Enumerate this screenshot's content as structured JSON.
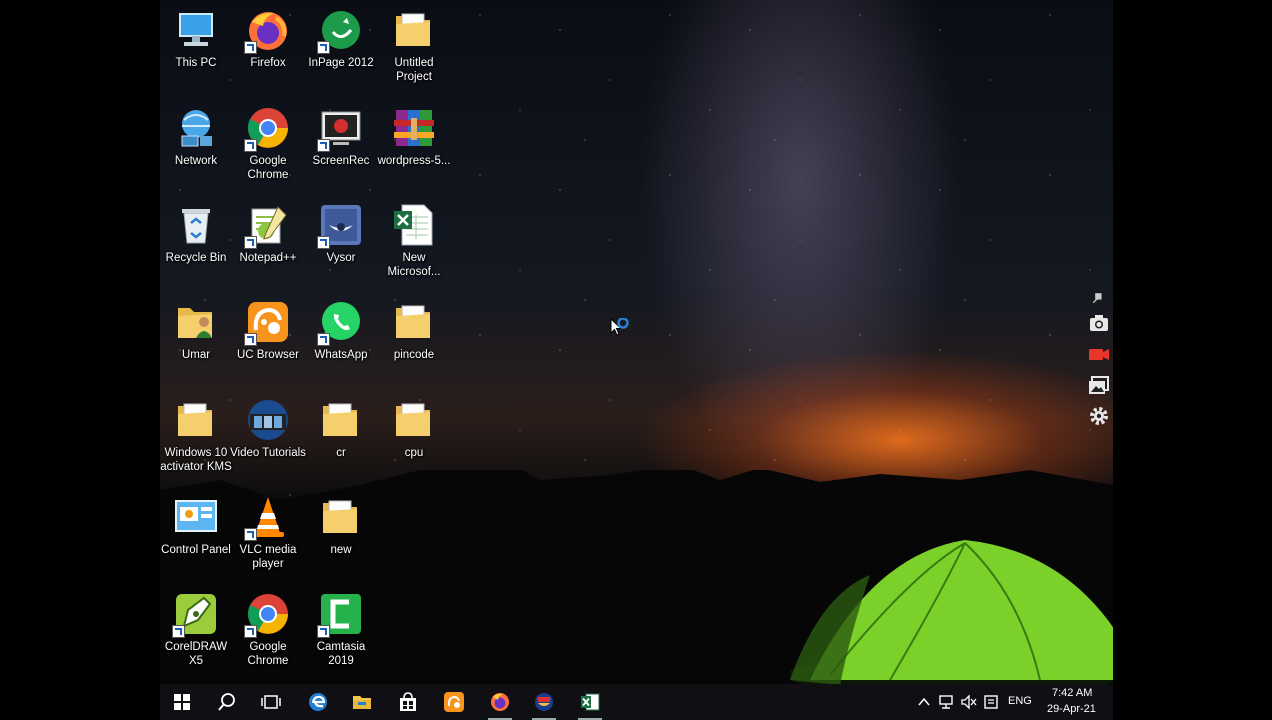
{
  "desktop_icons": [
    {
      "label": "This PC",
      "icon": "this-pc-icon",
      "shortcut": false
    },
    {
      "label": "Firefox",
      "icon": "firefox-icon",
      "shortcut": true
    },
    {
      "label": "InPage 2012",
      "icon": "inpage-icon",
      "shortcut": true
    },
    {
      "label": "Untitled Project",
      "icon": "folder-icon",
      "shortcut": false
    },
    {
      "label": "Network",
      "icon": "network-icon",
      "shortcut": false
    },
    {
      "label": "Google Chrome",
      "icon": "chrome-icon",
      "shortcut": true
    },
    {
      "label": "ScreenRec",
      "icon": "screenrec-icon",
      "shortcut": true
    },
    {
      "label": "wordpress-5...",
      "icon": "winrar-archive-icon",
      "shortcut": false
    },
    {
      "label": "Recycle Bin",
      "icon": "recycle-bin-icon",
      "shortcut": false
    },
    {
      "label": "Notepad++",
      "icon": "notepad-plus-plus-icon",
      "shortcut": true
    },
    {
      "label": "Vysor",
      "icon": "vysor-icon",
      "shortcut": true
    },
    {
      "label": "New Microsof...",
      "icon": "excel-file-icon",
      "shortcut": false
    },
    {
      "label": "Umar",
      "icon": "user-folder-icon",
      "shortcut": false
    },
    {
      "label": "UC Browser",
      "icon": "uc-browser-icon",
      "shortcut": true
    },
    {
      "label": "WhatsApp",
      "icon": "whatsapp-icon",
      "shortcut": true
    },
    {
      "label": "pincode",
      "icon": "folder-icon",
      "shortcut": false
    },
    {
      "label": "Windows 10 activator KMS",
      "icon": "folder-icon",
      "shortcut": false
    },
    {
      "label": "Video Tutorials",
      "icon": "video-tutorials-icon",
      "shortcut": false
    },
    {
      "label": "cr",
      "icon": "folder-icon",
      "shortcut": false
    },
    {
      "label": "cpu",
      "icon": "folder-icon",
      "shortcut": false
    },
    {
      "label": "Control Panel",
      "icon": "control-panel-icon",
      "shortcut": false
    },
    {
      "label": "VLC media player",
      "icon": "vlc-icon",
      "shortcut": true
    },
    {
      "label": "new",
      "icon": "folder-icon",
      "shortcut": false
    },
    {
      "label": "CorelDRAW X5",
      "icon": "coreldraw-icon",
      "shortcut": true
    },
    {
      "label": "Google Chrome",
      "icon": "chrome-icon",
      "shortcut": true
    },
    {
      "label": "Camtasia 2019",
      "icon": "camtasia-icon",
      "shortcut": true
    }
  ],
  "recorder_toolbar": [
    "pin-icon",
    "camera-icon",
    "video-record-icon",
    "gallery-icon",
    "settings-gear-icon"
  ],
  "taskbar": {
    "items": [
      "windows-start-icon",
      "search-icon",
      "task-view-icon",
      "edge-icon",
      "file-explorer-icon",
      "store-icon",
      "uc-browser-icon",
      "firefox-icon",
      "vysor-icon",
      "excel-icon"
    ],
    "tray": {
      "icons": [
        "chevron-up-icon",
        "network-icon",
        "volume-muted-icon",
        "notifications-icon"
      ],
      "language": "ENG",
      "time": "7:42 AM",
      "date": "29-Apr-21"
    }
  }
}
